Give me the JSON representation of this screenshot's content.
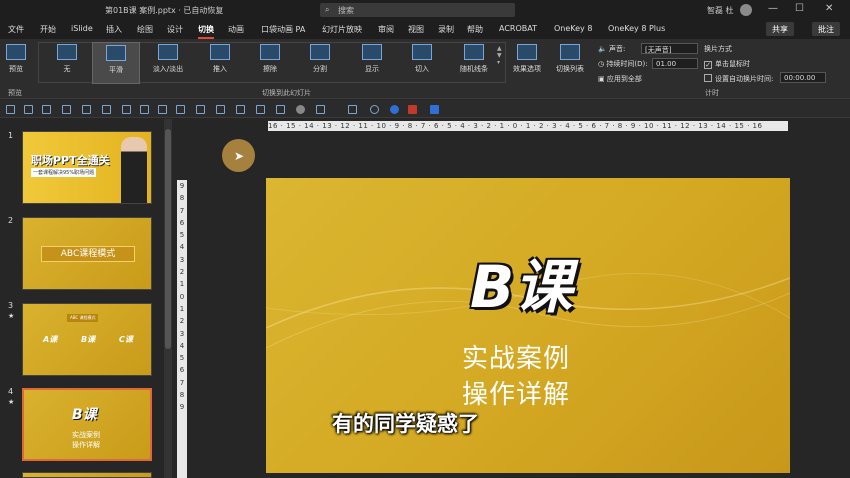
{
  "titlebar": {
    "file_title": "第01B课 案例.pptx · 已自动恢复",
    "search_placeholder": "搜索",
    "user_name": "智磊 杜",
    "min": "—",
    "max": "☐",
    "close": "✕"
  },
  "menu": {
    "tabs": [
      "文件",
      "开始",
      "iSlide",
      "插入",
      "绘图",
      "设计",
      "切换",
      "动画",
      "口袋动画 PA",
      "幻灯片放映",
      "审阅",
      "视图",
      "录制",
      "帮助",
      "ACROBAT",
      "OneKey 8",
      "OneKey 8 Plus"
    ],
    "active_index": 6,
    "share": "共享",
    "comment": "批注"
  },
  "ribbon": {
    "preview": "预览",
    "preview_group": "预览",
    "transitions": [
      "无",
      "平滑",
      "淡入/淡出",
      "推入",
      "擦除",
      "分割",
      "显示",
      "切入",
      "随机线条"
    ],
    "selected_transition": 1,
    "effect_options": "效果选项",
    "transition_list": "切换列表",
    "group_label": "切换到此幻灯片",
    "sound_label": "声音:",
    "sound_value": "[无声音]",
    "duration_label": "持续时间(D):",
    "duration_value": "01.00",
    "apply_all": "应用到全部",
    "advance_title": "换片方式",
    "on_click": "单击鼠标时",
    "after_time": "设置自动换片时间:",
    "after_time_value": "00:00.00",
    "timing_group": "计时"
  },
  "slides": {
    "numbers": [
      "1",
      "2",
      "3",
      "4"
    ],
    "s1_title": "职场PPT全通关",
    "s1_sub": "一套课程解决95%职场问题",
    "s2_title": "ABC课程模式",
    "s3_items": [
      "A课",
      "B课",
      "C课"
    ],
    "s3_head": "ABC 课程模式",
    "s4_big": "B课",
    "s4_l1": "实战案例",
    "s4_l2": "操作详解"
  },
  "rulers": {
    "h": "16 · 15 · 14 · 13 · 12 · 11 · 10 · 9 · 8 · 7 · 6 · 5 · 4 · 3 · 2 · 1 · 0 · 1 · 2 · 3 · 4 · 5 · 6 · 7 · 8 · 9 · 10 · 11 · 12 · 13 · 14 · 15 · 16",
    "v": [
      "9",
      "8",
      "7",
      "6",
      "5",
      "4",
      "3",
      "2",
      "1",
      "0",
      "1",
      "2",
      "3",
      "4",
      "5",
      "6",
      "7",
      "8",
      "9"
    ]
  },
  "canvas": {
    "big": "B课",
    "line1": "实战案例",
    "line2": "操作详解"
  },
  "caption": "有的同学疑惑了"
}
